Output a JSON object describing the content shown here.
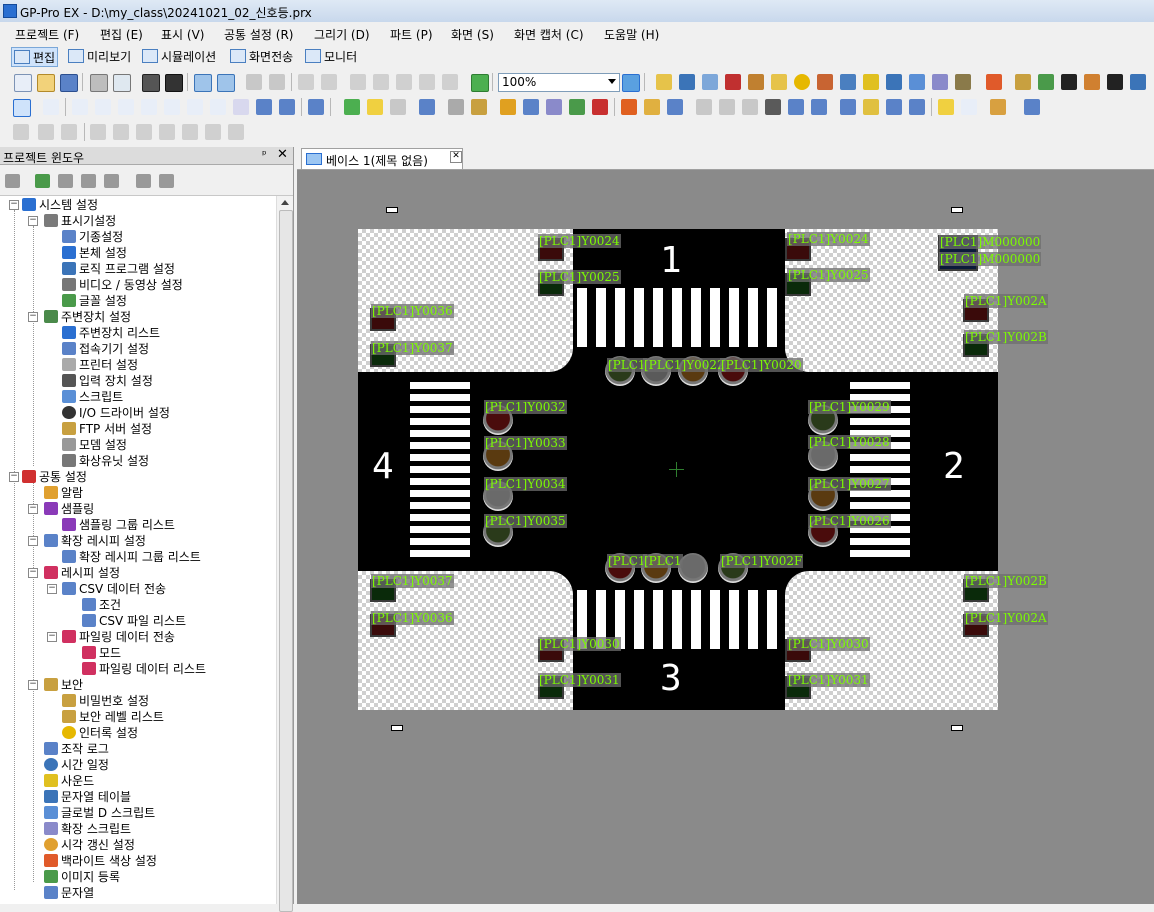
{
  "window": {
    "title": "GP-Pro EX - D:\\my_class\\20241021_02_신호등.prx"
  },
  "menu": [
    "프로젝트 (F)",
    "편집 (E)",
    "표시 (V)",
    "공통 설정 (R)",
    "그리기 (D)",
    "파트 (P)",
    "화면 (S)",
    "화면 캡처 (C)",
    "도움말 (H)"
  ],
  "modes": [
    "편집",
    "미리보기",
    "시뮬레이션",
    "화면전송",
    "모니터"
  ],
  "zoom": "100%",
  "project_window": {
    "title": "프로젝트 윈도우",
    "pin": "ᵖ",
    "close": "✕",
    "tree": [
      "시스템 설정",
      "표시기설정",
      "기종설정",
      "본체 설정",
      "로직 프로그램 설정",
      "비디오 / 동영상 설정",
      "글꼴 설정",
      "주변장치 설정",
      "주변장치 리스트",
      "접속기기 설정",
      "프린터 설정",
      "입력 장치 설정",
      "스크립트",
      "I/O 드라이버 설정",
      "FTP 서버 설정",
      "모뎀 설정",
      "화상유닛 설정",
      "공통 설정",
      "알람",
      "샘플링",
      "샘플링 그룹 리스트",
      "확장 레시피 설정",
      "확장 레시피 그룹 리스트",
      "레시피 설정",
      "CSV 데이터 전송",
      "조건",
      "CSV 파일 리스트",
      "파일링 데이터 전송",
      "모드",
      "파일링 데이터 리스트",
      "보안",
      "비밀번호 설정",
      "보안 레벨 리스트",
      "인터록 설정",
      "조작 로그",
      "시간 일정",
      "사운드",
      "문자열 테이블",
      "글로벌 D 스크립트",
      "확장 스크립트",
      "시각 갱신 설정",
      "백라이트 색상 설정",
      "이미지 등록",
      "문자열"
    ]
  },
  "doc_tab": {
    "title": "베이스 1(제목 없음)",
    "close": "✕"
  },
  "screen": {
    "numbers": [
      "1",
      "2",
      "3",
      "4"
    ],
    "tags": [
      "[PLC1]Y0024",
      "[PLC1]Y0025",
      "[PLC1]Y0024",
      "[PLC1]Y0025",
      "[PLC1]M000000",
      "[PLC1]M000000",
      "[PLC1]Y0036",
      "[PLC1]Y0037",
      "[PLC1]Y002A",
      "[PLC1]Y002B",
      "[PLC1]Y0022",
      "[PLC1]Y0020",
      "[PLC1]Y0032",
      "[PLC1]Y0033",
      "[PLC1]Y0034",
      "[PLC1]Y0035",
      "[PLC1]Y0029",
      "[PLC1]Y0028",
      "[PLC1]Y0027",
      "[PLC1]Y0026",
      "[PLC1]Y002F",
      "[PLC1]Y0037",
      "[PLC1]Y0036",
      "[PLC1]Y002B",
      "[PLC1]Y002A",
      "[PLC1]Y0030",
      "[PLC1]Y0031",
      "[PLC1]Y0030",
      "[PLC1]Y0031",
      "[PLC1",
      "[PLC1",
      "[PLC1"
    ]
  },
  "colors": {
    "accent": "#2a6fd1",
    "tag_text": "#7cfc00",
    "canvas": "#8a8a8a"
  }
}
